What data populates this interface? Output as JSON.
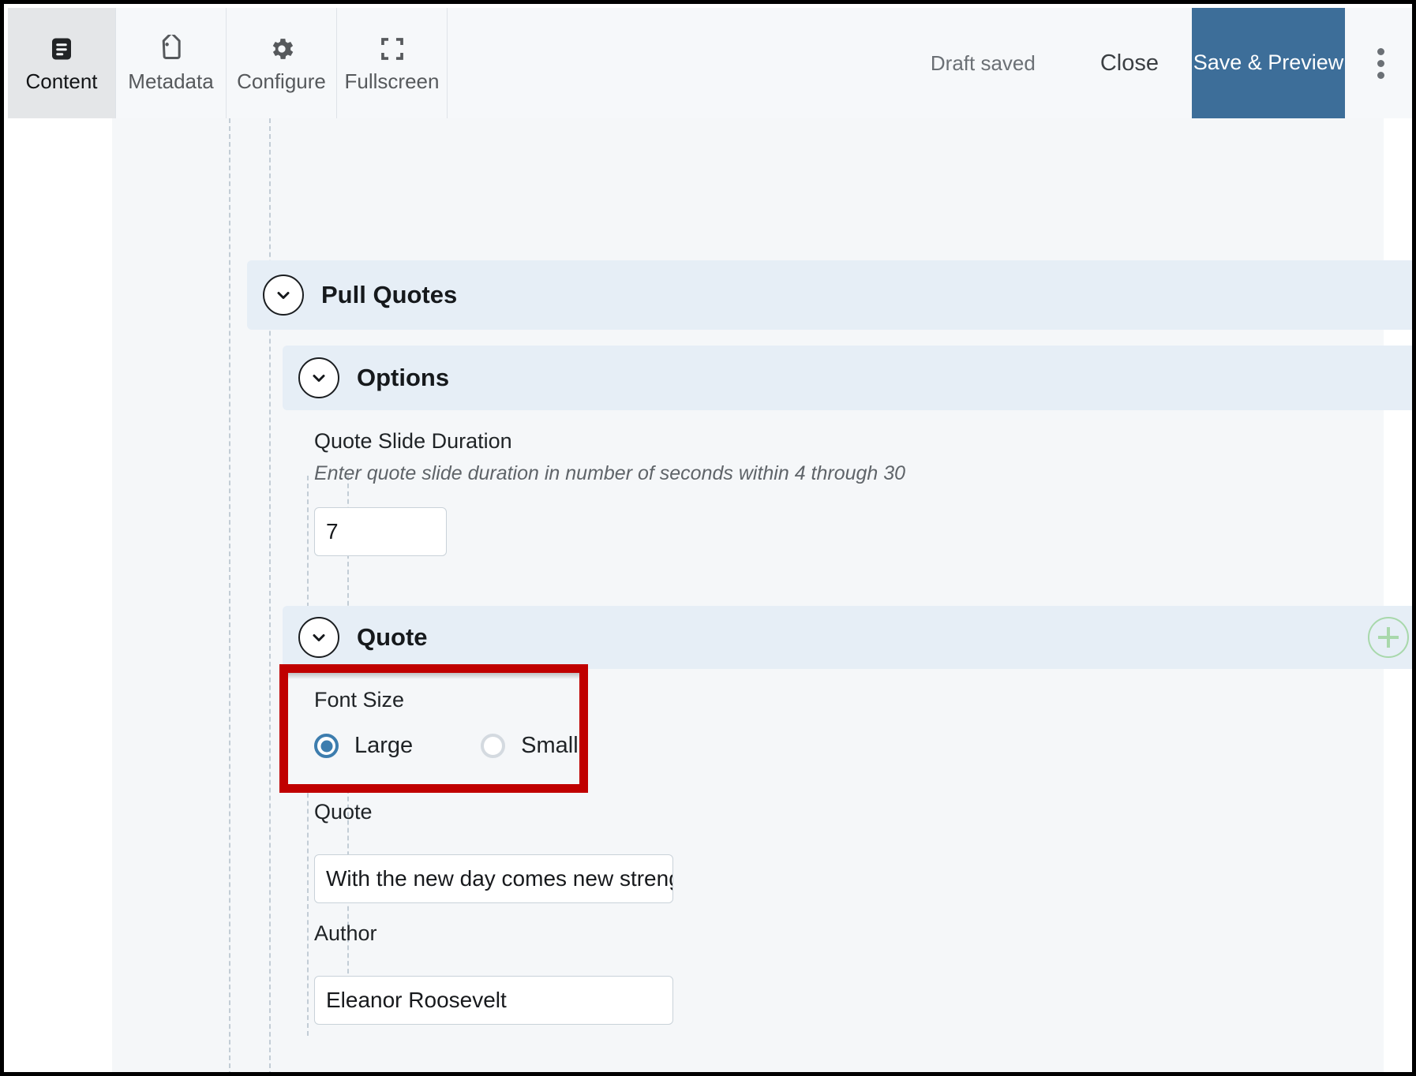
{
  "toolbar": {
    "tabs": [
      {
        "label": "Content",
        "icon": "document-lines-icon",
        "active": true
      },
      {
        "label": "Metadata",
        "icon": "tag-icon",
        "active": false
      },
      {
        "label": "Configure",
        "icon": "gear-icon",
        "active": false
      },
      {
        "label": "Fullscreen",
        "icon": "fullscreen-icon",
        "active": false
      }
    ],
    "status": "Draft saved",
    "close_label": "Close",
    "save_preview_label": "Save & Preview",
    "overflow_icon": "kebab-menu-icon",
    "accent_color": "#3d6e99"
  },
  "sections": {
    "pull_quotes": {
      "title": "Pull Quotes",
      "collapse_icon": "chevron-down-icon"
    },
    "options": {
      "title": "Options",
      "collapse_icon": "chevron-down-icon"
    },
    "quote": {
      "title": "Quote",
      "collapse_icon": "chevron-down-icon",
      "add_icon": "plus-circle-icon"
    }
  },
  "fields": {
    "duration": {
      "label": "Quote Slide Duration",
      "hint": "Enter quote slide duration in number of seconds within 4 through 30",
      "value": "7",
      "placeholder": ""
    },
    "font_size": {
      "label": "Font Size",
      "options": [
        {
          "label": "Large",
          "selected": true
        },
        {
          "label": "Small",
          "selected": false
        }
      ],
      "highlight_color": "#c00000"
    },
    "quote": {
      "label": "Quote",
      "value": "With the new day comes new strength",
      "placeholder": ""
    },
    "author": {
      "label": "Author",
      "value": "Eleanor Roosevelt",
      "placeholder": ""
    }
  }
}
